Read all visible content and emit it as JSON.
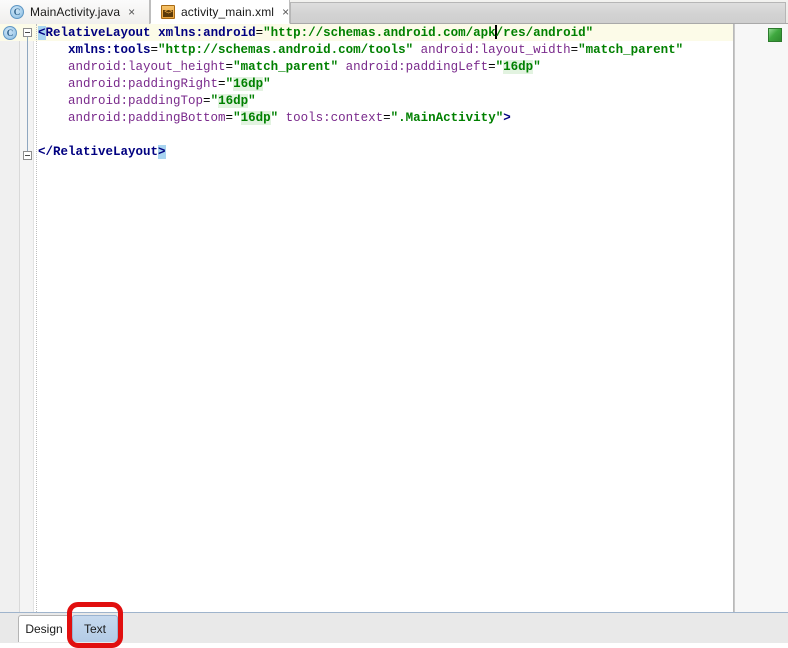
{
  "window": {
    "app": "Android Studio XML Layout Editor"
  },
  "tabs": [
    {
      "label": "MainActivity.java",
      "icon": "java-class-icon",
      "icon_glyph": "C",
      "close_glyph": "×",
      "active": false
    },
    {
      "label": "activity_main.xml",
      "icon": "xml-file-icon",
      "icon_glyph": "<>",
      "close_glyph": "×",
      "active": true
    }
  ],
  "gutter": {
    "line1_icon": "java-class-icon",
    "line1_icon_glyph": "C",
    "fold_markers": [
      "minus",
      "minus"
    ]
  },
  "editor": {
    "file": "activity_main.xml",
    "code_lines": [
      "<RelativeLayout xmlns:android=\"http://schemas.android.com/apk/res/android\"",
      "    xmlns:tools=\"http://schemas.android.com/tools\" android:layout_width=\"match_parent\"",
      "    android:layout_height=\"match_parent\" android:paddingLeft=\"16dp\"",
      "    android:paddingRight=\"16dp\"",
      "    android:paddingTop=\"16dp\"",
      "    android:paddingBottom=\"16dp\" tools:context=\".MainActivity\">",
      "",
      "</RelativeLayout>"
    ],
    "caret_line": 1,
    "caret_after_text": "apk",
    "highlighted_tag_open": "<",
    "highlighted_tag_close": ">",
    "resource_values": [
      "16dp",
      "16dp",
      "16dp",
      "16dp"
    ]
  },
  "markers": {
    "inspection_status": "green",
    "inspection_status_color": "#3fa83f"
  },
  "bottom_tabs": [
    {
      "label": "Design",
      "active": false
    },
    {
      "label": "Text",
      "active": true
    }
  ],
  "annotation": {
    "shape": "rounded-rectangle",
    "color": "#e10f0f",
    "target": "Text"
  }
}
